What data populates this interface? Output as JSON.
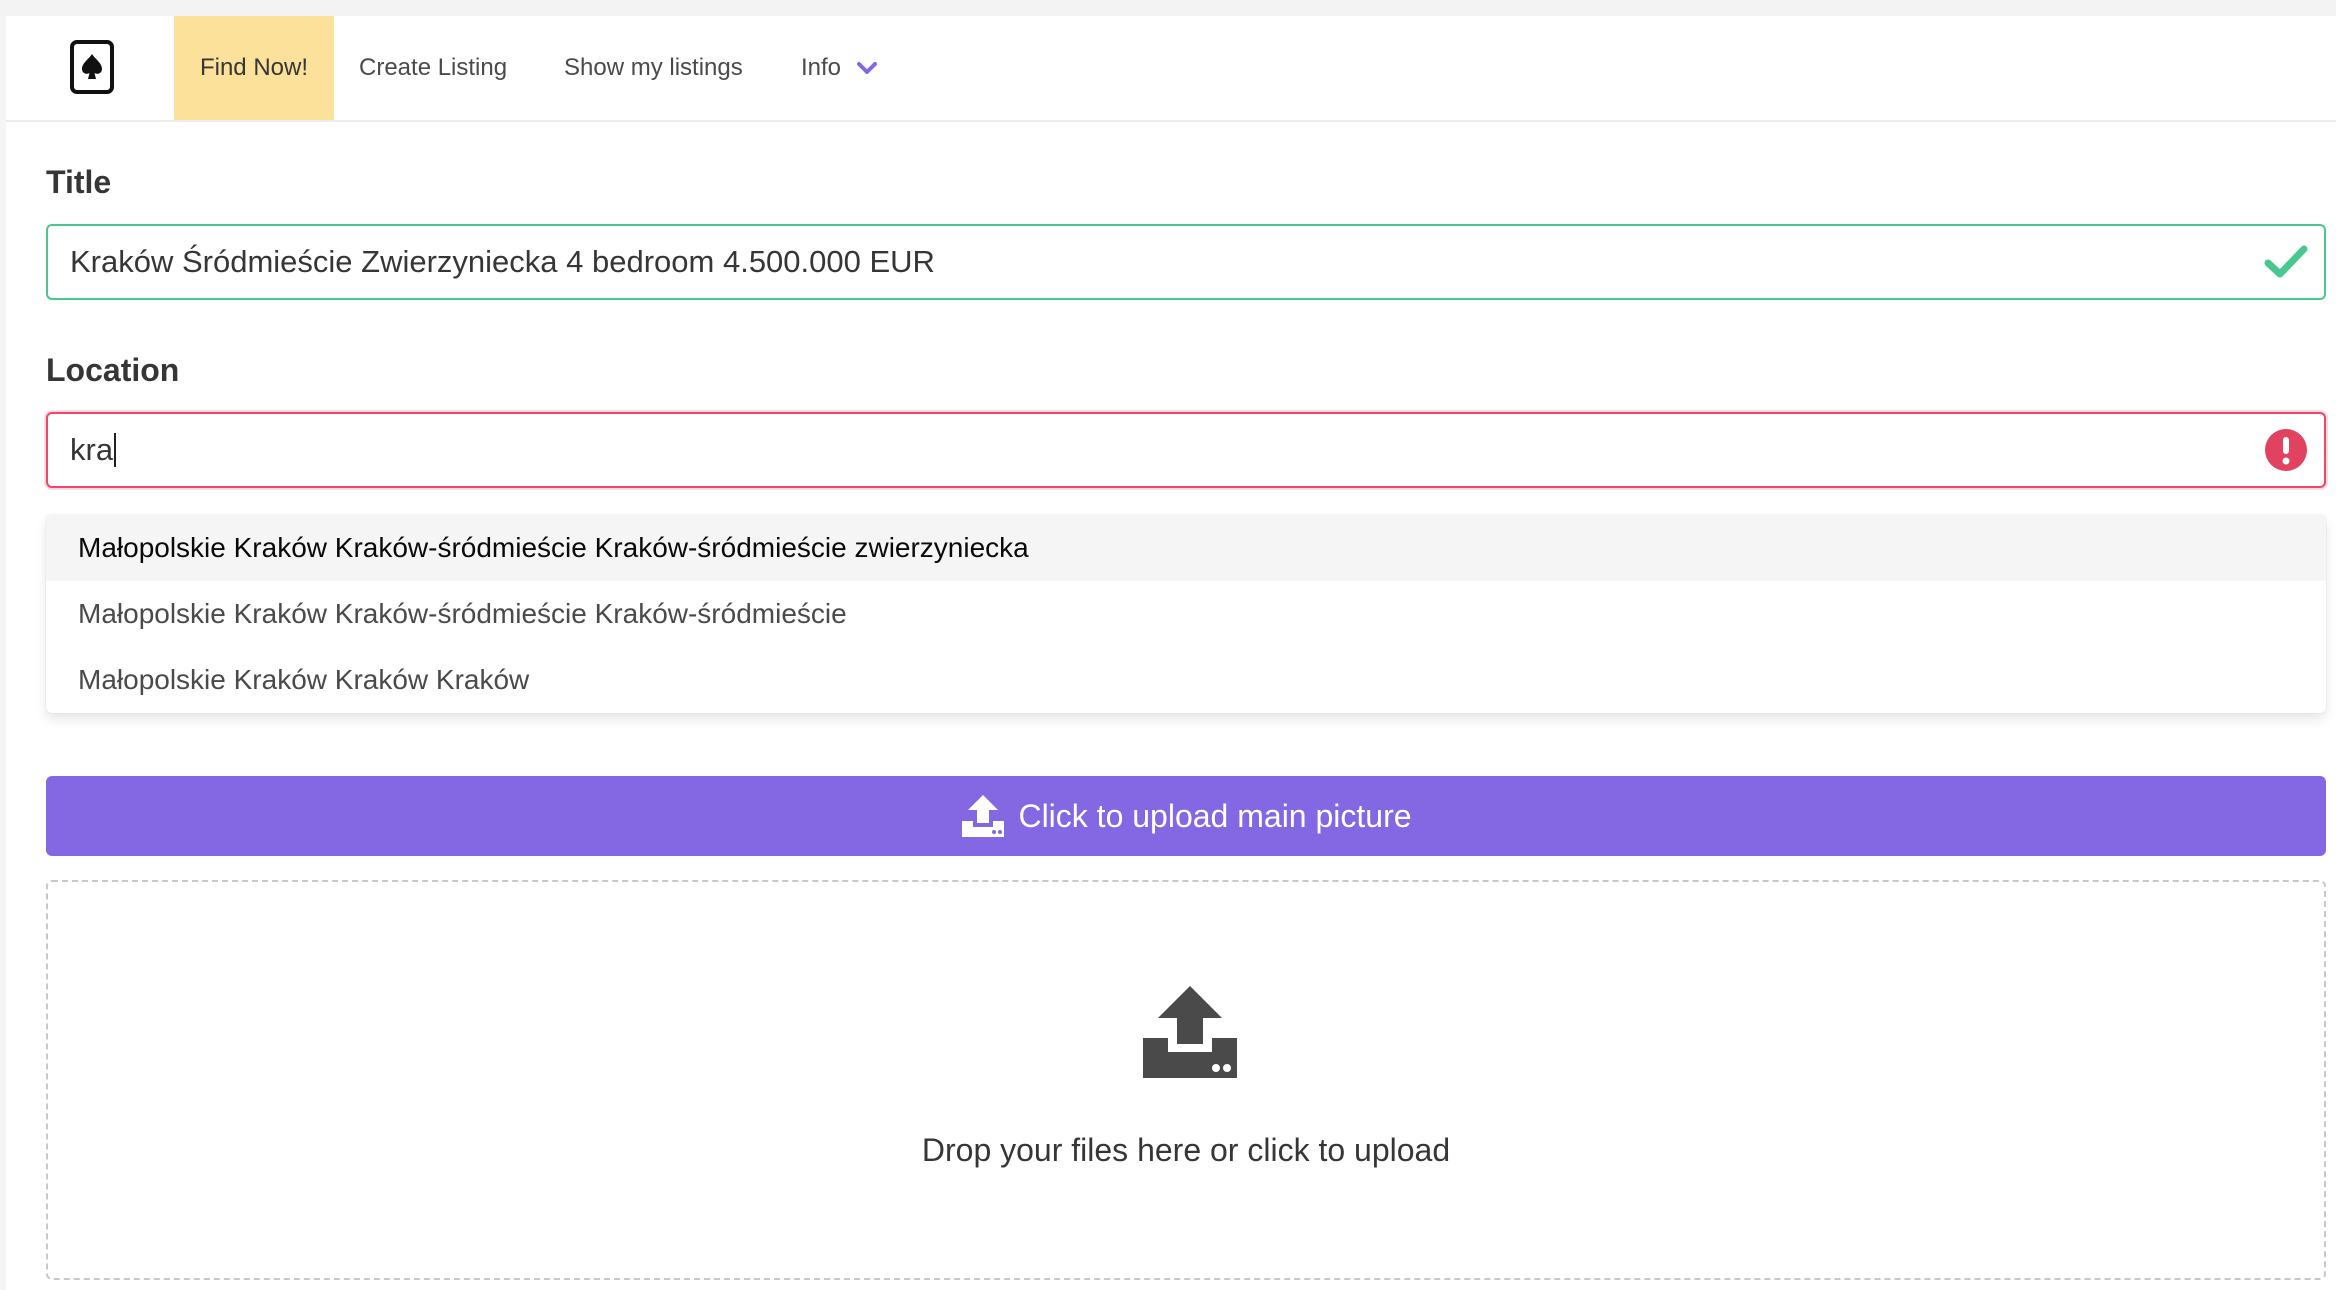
{
  "nav": {
    "logo_icon": "spade-card-icon",
    "items": [
      {
        "label": "Find Now!",
        "active": true
      },
      {
        "label": "Create Listing"
      },
      {
        "label": "Show my listings"
      },
      {
        "label": "Info",
        "icon": "chevron-down-icon"
      }
    ],
    "active_bg_color": "#fbe19a",
    "chevron_color": "#8468e3"
  },
  "form": {
    "title_label": "Title",
    "title_value": "Kraków Śródmieście Zwierzyniecka 4 bedroom 4.500.000 EUR",
    "title_status": "valid",
    "title_status_icon": "checkmark-icon",
    "location_label": "Location",
    "location_value": "kra",
    "location_status": "error",
    "location_status_icon": "exclamation-circle-icon",
    "suggestions": [
      "Małopolskie Kraków Kraków-śródmieście Kraków-śródmieście zwierzyniecka",
      "Małopolskie Kraków Kraków-śródmieście Kraków-śródmieście",
      "Małopolskie Kraków Kraków Kraków"
    ],
    "upload_button_label": "Click to upload main picture",
    "upload_icon": "upload-icon",
    "dropzone_text": "Drop your files here or click to upload"
  },
  "colors": {
    "success": "#48c78e",
    "danger": "#f14668",
    "primary": "#8468e3"
  }
}
